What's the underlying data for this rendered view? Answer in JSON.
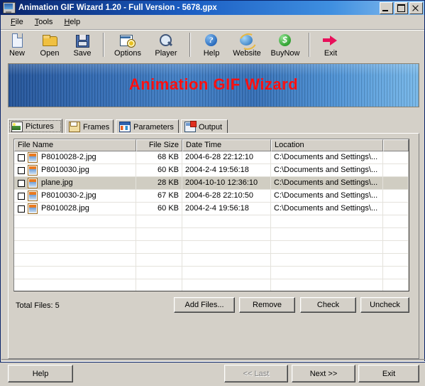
{
  "window": {
    "title": "Animation GIF Wizard 1.20 - Full Version - 5678.gpx",
    "icon": "app-window-icon",
    "controls": {
      "minimize": "minimize-button",
      "maximize": "maximize-button",
      "close": "close-button"
    }
  },
  "menu": {
    "items": [
      "File",
      "Tools",
      "Help"
    ]
  },
  "toolbar": {
    "buttons": [
      {
        "label": "New",
        "icon": "new-document-icon"
      },
      {
        "label": "Open",
        "icon": "open-folder-icon"
      },
      {
        "label": "Save",
        "icon": "save-floppy-icon"
      },
      {
        "label": "Options",
        "icon": "options-gear-icon"
      },
      {
        "label": "Player",
        "icon": "player-magnifier-icon"
      },
      {
        "label": "Help",
        "icon": "help-question-icon"
      },
      {
        "label": "Website",
        "icon": "website-browser-icon"
      },
      {
        "label": "BuyNow",
        "icon": "buynow-dollar-icon"
      },
      {
        "label": "Exit",
        "icon": "exit-arrow-icon"
      }
    ]
  },
  "banner": {
    "text": "Animation GIF Wizard",
    "text_color": "#ff1010",
    "background_color": "#2f6bb4"
  },
  "tabs": [
    {
      "label": "Pictures",
      "icon": "picture-icon",
      "selected": true
    },
    {
      "label": "Frames",
      "icon": "frames-icon",
      "selected": false
    },
    {
      "label": "Parameters",
      "icon": "parameters-icon",
      "selected": false
    },
    {
      "label": "Output",
      "icon": "output-icon",
      "selected": false
    }
  ],
  "file_list": {
    "columns": [
      "File Name",
      "File Size",
      "Date Time",
      "Location",
      ""
    ],
    "rows": [
      {
        "checked": false,
        "name": "P8010028-2.jpg",
        "size": "68 KB",
        "date": "2004-6-28 22:12:10",
        "location": "C:\\Documents and Settings\\...",
        "selected": false
      },
      {
        "checked": false,
        "name": "P8010030.jpg",
        "size": "60 KB",
        "date": "2004-2-4 19:56:18",
        "location": "C:\\Documents and Settings\\...",
        "selected": false
      },
      {
        "checked": false,
        "name": "plane.jpg",
        "size": "28 KB",
        "date": "2004-10-10 12:36:10",
        "location": "C:\\Documents and Settings\\...",
        "selected": true
      },
      {
        "checked": false,
        "name": "P8010030-2.jpg",
        "size": "67 KB",
        "date": "2004-6-28 22:10:50",
        "location": "C:\\Documents and Settings\\...",
        "selected": false
      },
      {
        "checked": false,
        "name": "P8010028.jpg",
        "size": "60 KB",
        "date": "2004-2-4 19:56:18",
        "location": "C:\\Documents and Settings\\...",
        "selected": false
      }
    ],
    "empty_rows": 8
  },
  "status": {
    "total_files": "Total Files: 5"
  },
  "actions": {
    "add_files": "Add Files...",
    "remove": "Remove",
    "check": "Check",
    "uncheck": "Uncheck"
  },
  "navigation": {
    "help": "Help",
    "last": "<< Last",
    "last_disabled": true,
    "next": "Next >>",
    "exit": "Exit"
  }
}
